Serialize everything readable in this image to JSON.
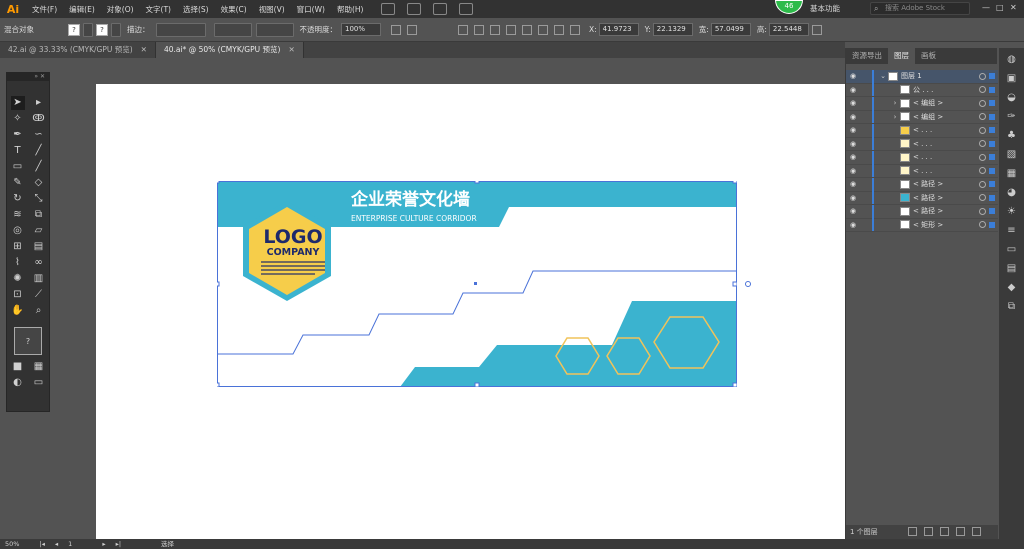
{
  "app": {
    "logo": "Ai"
  },
  "menu": [
    "文件(F)",
    "编辑(E)",
    "对象(O)",
    "文字(T)",
    "选择(S)",
    "效果(C)",
    "视图(V)",
    "窗口(W)",
    "帮助(H)"
  ],
  "topbar": {
    "badge": "46",
    "workspace": "基本功能",
    "search_placeholder": "搜索 Adobe Stock"
  },
  "control": {
    "object_type": "混合对象",
    "stroke_label": "描边：",
    "opacity_label": "不透明度：",
    "opacity_value": "100%",
    "x_label": "X:",
    "x_value": "41.9723",
    "y_label": "Y:",
    "y_value": "22.1329",
    "w_label": "宽:",
    "w_value": "57.0499",
    "h_label": "高:",
    "h_value": "22.5448"
  },
  "tabs": [
    {
      "label": "42.ai @ 33.33% (CMYK/GPU 预览)",
      "active": false
    },
    {
      "label": "40.ai* @ 50% (CMYK/GPU 预览)",
      "active": true
    }
  ],
  "design": {
    "title": "企业荣誉文化墙",
    "subtitle": "ENTERPRISE CULTURE CORRIDOR",
    "logo": "LOGO",
    "company": "COMPANY",
    "colors": {
      "blue": "#3bb3cf",
      "yellow": "#f6cd4a",
      "navy": "#1e2a6b",
      "hex_outline": "#f1c35a"
    }
  },
  "panel": {
    "tabs": [
      "资源导出",
      "图层",
      "画板"
    ],
    "active_tab": "图层",
    "layers": [
      {
        "name": "图层 1",
        "caret": "⌄",
        "thumb": "#ffffff"
      },
      {
        "name": "公 . . .",
        "caret": "",
        "thumb": "#ffffff"
      },
      {
        "name": "< 编组 >",
        "caret": "›",
        "thumb": "#ffffff"
      },
      {
        "name": "< 编组 >",
        "caret": "›",
        "thumb": "#ffffff"
      },
      {
        "name": "< . . .",
        "caret": "",
        "thumb": "#f6cd4a"
      },
      {
        "name": "< . . .",
        "caret": "",
        "thumb": "#fff5c8"
      },
      {
        "name": "< . . .",
        "caret": "",
        "thumb": "#fff5c8"
      },
      {
        "name": "< . . .",
        "caret": "",
        "thumb": "#fff5c8"
      },
      {
        "name": "< 路径 >",
        "caret": "",
        "thumb": "#ffffff"
      },
      {
        "name": "< 路径 >",
        "caret": "",
        "thumb": "#3bb3cf"
      },
      {
        "name": "< 路径 >",
        "caret": "",
        "thumb": "#ffffff"
      },
      {
        "name": "< 矩形 >",
        "caret": "",
        "thumb": "#ffffff"
      }
    ],
    "footer": "1 个图层"
  },
  "status": {
    "zoom": "50%",
    "page": "1",
    "mode": "选择"
  }
}
